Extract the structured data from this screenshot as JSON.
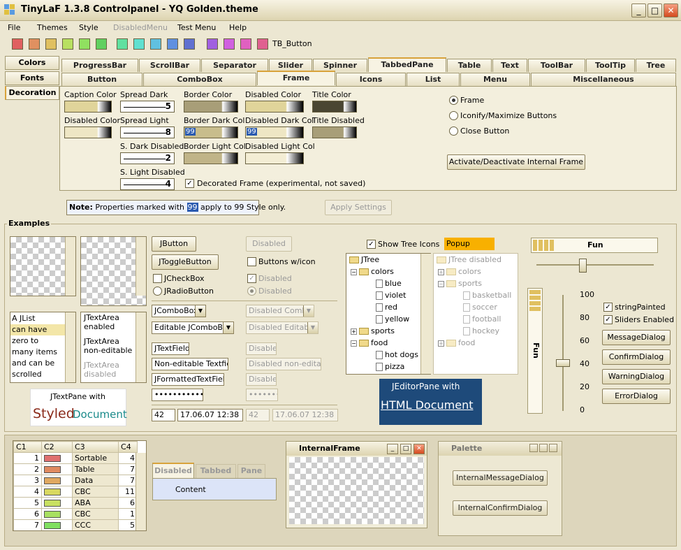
{
  "window": {
    "title": "TinyLaF 1.3.8 Controlpanel - YQ Golden.theme",
    "minimize": "_",
    "maximize": "□",
    "close": "✕"
  },
  "menu": [
    "File",
    "Themes",
    "Style",
    "DisabledMenu",
    "Test Menu",
    "Help"
  ],
  "toolbar": {
    "swatches": [
      "#e06060",
      "#e09060",
      "#e0c060",
      "#b8e060",
      "#90e060",
      "#60d060",
      "#60e0a0",
      "#60e0d0",
      "#60c0e0",
      "#6090e0",
      "#6070d0",
      "#a060e0",
      "#d060e0",
      "#e060c0",
      "#e06090"
    ],
    "button_label": "TB_Button"
  },
  "tabs_row1": [
    "ProgressBar",
    "ScrollBar",
    "Separator",
    "Slider",
    "Spinner",
    "TabbedPane",
    "Table",
    "Text",
    "ToolBar",
    "ToolTip",
    "Tree"
  ],
  "tabs_row2": [
    "Button",
    "ComboBox",
    "Frame",
    "Icons",
    "List",
    "Menu",
    "Miscellaneous"
  ],
  "left_tabs": [
    "Colors",
    "Fonts",
    "Decoration"
  ],
  "frame_panel": {
    "caption_color": "Caption Color",
    "disabled_color": "Disabled Color",
    "spread_dark": "Spread Dark",
    "spread_dark_val": "5",
    "spread_light": "Spread Light",
    "spread_light_val": "8",
    "s_dark_disabled": "S. Dark Disabled",
    "s_dark_disabled_val": "2",
    "s_light_disabled": "S. Light Disabled",
    "s_light_disabled_val": "4",
    "border_color": "Border Color",
    "border_dark_col": "Border Dark Col",
    "border_light_col": "Border Light Col",
    "disabled_color2": "Disabled Color",
    "disabled_dark_col": "Disabled Dark Col",
    "disabled_light_col": "Disabled Light Col",
    "title_color": "Title Color",
    "title_disabled": "Title Disabled",
    "badge99": "99",
    "decorated": "Decorated Frame (experimental, not saved)",
    "radio_frame": "Frame",
    "radio_iconify": "Iconify/Maximize Buttons",
    "radio_close": "Close Button",
    "activate_btn": "Activate/Deactivate Internal Frame"
  },
  "note": {
    "bold": "Note:",
    "text1": "Properties marked with",
    "badge": "99",
    "text2": "apply to 99 Style only."
  },
  "apply_settings": "Apply Settings",
  "examples_label": "Examples",
  "ex": {
    "jlist": [
      "A JList",
      "can have",
      "zero to",
      "many items",
      "and can be",
      "scrolled"
    ],
    "textareas": [
      "JTextArea enabled",
      "JTextArea non-editable",
      "JTextArea disabled"
    ],
    "jtextpane": "JTextPane with",
    "styled": "Styled",
    "document": "Document",
    "jbutton": "JButton",
    "jtoggle": "JToggleButton",
    "jcheckbox": "JCheckBox",
    "jradio": "JRadioButton",
    "disabled": "Disabled",
    "buttons_icon": "Buttons w/icon",
    "jcombo": "JComboBox",
    "editable_combo": "Editable JComboBox",
    "dis_combo": "Disabled Combo",
    "dis_editable": "Disabled Editable",
    "jtextfield": "JTextField",
    "noneditable_tf": "Non-editable Textfield",
    "dis_noneditable": "Disabled non-editable",
    "jformatted": "JFormattedTextField",
    "password": "•••••••••••••••",
    "password_dis": "••••••••",
    "spin1": "42",
    "spin2": "17.06.07 12:38",
    "show_tree_icons": "Show Tree Icons",
    "popup_trigger": "Popup trigger",
    "tree": [
      "JTree",
      "colors",
      "blue",
      "violet",
      "red",
      "yellow",
      "sports",
      "food",
      "hot dogs",
      "pizza"
    ],
    "tree_dis": [
      "JTree disabled",
      "colors",
      "sports",
      "basketball",
      "soccer",
      "football",
      "hockey",
      "food"
    ],
    "editor_line1": "JEditorPane with",
    "editor_line2": "HTML Document",
    "fun": "Fun",
    "slider_ticks": [
      "100",
      "80",
      "60",
      "40",
      "20",
      "0"
    ],
    "string_painted": "stringPainted",
    "sliders_enabled": "Sliders Enabled",
    "dialogs": [
      "MessageDialog",
      "ConfirmDialog",
      "WarningDialog",
      "ErrorDialog"
    ]
  },
  "table": {
    "headers": [
      "C1",
      "C2",
      "C3",
      "C4"
    ],
    "rows": [
      {
        "c1": "1",
        "color": "#e07070",
        "c3": "Sortable",
        "c4": "4"
      },
      {
        "c1": "2",
        "color": "#e08a60",
        "c3": "Table",
        "c4": "7"
      },
      {
        "c1": "3",
        "color": "#e0a860",
        "c3": "Data",
        "c4": "7"
      },
      {
        "c1": "4",
        "color": "#d8d860",
        "c3": "CBC",
        "c4": "11"
      },
      {
        "c1": "5",
        "color": "#c8e060",
        "c3": "ABA",
        "c4": "6"
      },
      {
        "c1": "6",
        "color": "#a8e060",
        "c3": "CBC",
        "c4": "1"
      },
      {
        "c1": "7",
        "color": "#80e060",
        "c3": "CCC",
        "c4": "5"
      }
    ]
  },
  "tabbedpane": {
    "tabs": [
      "Disabled",
      "Tabbed",
      "Pane"
    ],
    "content": "Content"
  },
  "internal_frame": {
    "title": "InternalFrame"
  },
  "palette": {
    "title": "Palette",
    "btn1": "InternalMessageDialog",
    "btn2": "InternalConfirmDialog"
  }
}
